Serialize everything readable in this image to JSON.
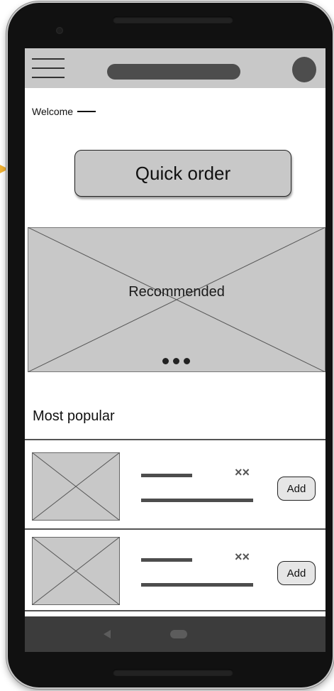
{
  "welcome": {
    "label": "Welcome"
  },
  "quick_order": {
    "label": "Quick order"
  },
  "banner": {
    "label": "Recommended",
    "carousel_dots": 3
  },
  "popular": {
    "title": "Most popular",
    "items": [
      {
        "add_label": "Add",
        "remove_glyph": "××"
      },
      {
        "add_label": "Add",
        "remove_glyph": "××"
      }
    ]
  },
  "icons": {
    "menu": "hamburger-icon",
    "avatar": "avatar",
    "back": "back-triangle-icon",
    "home": "home-pill-icon"
  },
  "colors": {
    "frame": "#111111",
    "appbar": "#c8c8c8",
    "placeholder_fill": "#c8c8c8",
    "bars": "#4d4d4d",
    "navbar": "#3c3c3c",
    "accent_arrow": "#f2b233"
  }
}
